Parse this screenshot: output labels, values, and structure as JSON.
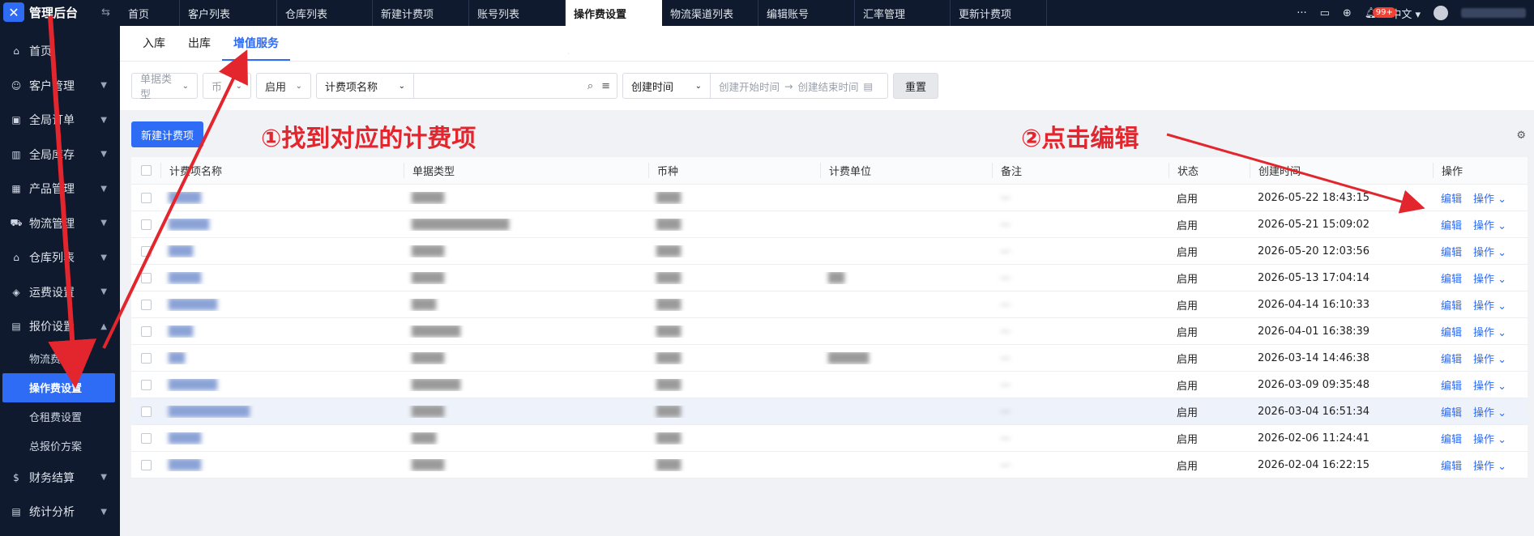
{
  "app": {
    "title": "管理后台"
  },
  "sidebar": {
    "items": [
      {
        "label": "首页",
        "icon": "home-icon"
      },
      {
        "label": "客户管理",
        "icon": "users-icon"
      },
      {
        "label": "全局订单",
        "icon": "order-icon"
      },
      {
        "label": "全局库存",
        "icon": "stock-icon"
      },
      {
        "label": "产品管理",
        "icon": "product-icon"
      },
      {
        "label": "物流管理",
        "icon": "truck-icon"
      },
      {
        "label": "仓库列表",
        "icon": "warehouse-icon"
      },
      {
        "label": "运费设置",
        "icon": "freight-icon"
      },
      {
        "label": "报价设置",
        "icon": "quote-icon",
        "expanded": true
      }
    ],
    "subitems": [
      {
        "label": "物流费设置"
      },
      {
        "label": "操作费设置",
        "active": true
      },
      {
        "label": "仓租费设置"
      },
      {
        "label": "总报价方案"
      }
    ],
    "bottom_items": [
      {
        "label": "财务结算",
        "icon": "finance-icon"
      },
      {
        "label": "统计分析",
        "icon": "stats-icon"
      }
    ]
  },
  "topnav": {
    "tabs": [
      "首页",
      "客户列表",
      "仓库列表",
      "新建计费项",
      "账号列表",
      "操作费设置",
      "物流渠道列表",
      "编辑账号",
      "汇率管理",
      "更新计费项"
    ],
    "active_index": 5,
    "more": "···",
    "notifications_badge": "99+",
    "language": "中文"
  },
  "subtabs": {
    "items": [
      "入库",
      "出库",
      "增值服务"
    ],
    "active_index": 2
  },
  "filters": {
    "doc_type_placeholder": "单据类型",
    "currency_placeholder": "币",
    "status_value": "启用",
    "search_field": "计费项名称",
    "date_field": "创建时间",
    "date_start_placeholder": "创建开始时间",
    "date_arrow": "→",
    "date_end_placeholder": "创建结束时间",
    "reset_label": "重置"
  },
  "toolbar": {
    "new_label": "新建计费项"
  },
  "table": {
    "headers": [
      "计费项名称",
      "单据类型",
      "币种",
      "计费单位",
      "备注",
      "状态",
      "创建时间",
      "操作"
    ],
    "edit_label": "编辑",
    "op_label": "操作",
    "rows": [
      {
        "name": "████",
        "type": "████",
        "currency": "███",
        "unit": "",
        "note": "—",
        "status": "启用",
        "time": "2026-05-22 18:43:15"
      },
      {
        "name": "█████",
        "type": "████████████",
        "currency": "███",
        "unit": "",
        "note": "—",
        "status": "启用",
        "time": "2026-05-21 15:09:02"
      },
      {
        "name": "███",
        "type": "████",
        "currency": "███",
        "unit": "",
        "note": "—",
        "status": "启用",
        "time": "2026-05-20 12:03:56"
      },
      {
        "name": "████",
        "type": "████",
        "currency": "███",
        "unit": "██",
        "note": "—",
        "status": "启用",
        "time": "2026-05-13 17:04:14"
      },
      {
        "name": "██████",
        "type": "███",
        "currency": "███",
        "unit": "",
        "note": "—",
        "status": "启用",
        "time": "2026-04-14 16:10:33"
      },
      {
        "name": "███",
        "type": "██████",
        "currency": "███",
        "unit": "",
        "note": "—",
        "status": "启用",
        "time": "2026-04-01 16:38:39"
      },
      {
        "name": "██",
        "type": "████",
        "currency": "███",
        "unit": "█████",
        "note": "—",
        "status": "启用",
        "time": "2026-03-14 14:46:38"
      },
      {
        "name": "██████",
        "type": "██████",
        "currency": "███",
        "unit": "",
        "note": "—",
        "status": "启用",
        "time": "2026-03-09 09:35:48"
      },
      {
        "name": "██████████",
        "type": "████",
        "currency": "███",
        "unit": "",
        "note": "—",
        "status": "启用",
        "time": "2026-03-04 16:51:34",
        "highlight": true
      },
      {
        "name": "████",
        "type": "███",
        "currency": "███",
        "unit": "",
        "note": "—",
        "status": "启用",
        "time": "2026-02-06 11:24:41"
      },
      {
        "name": "████",
        "type": "████",
        "currency": "███",
        "unit": "",
        "note": "—",
        "status": "启用",
        "time": "2026-02-04 16:22:15"
      }
    ]
  },
  "annotations": {
    "step1": "①找到对应的计费项",
    "step2": "②点击编辑"
  },
  "colors": {
    "accent": "#2f6cf6",
    "sidebar": "#0f1a2e",
    "annotation": "#e3262d"
  }
}
